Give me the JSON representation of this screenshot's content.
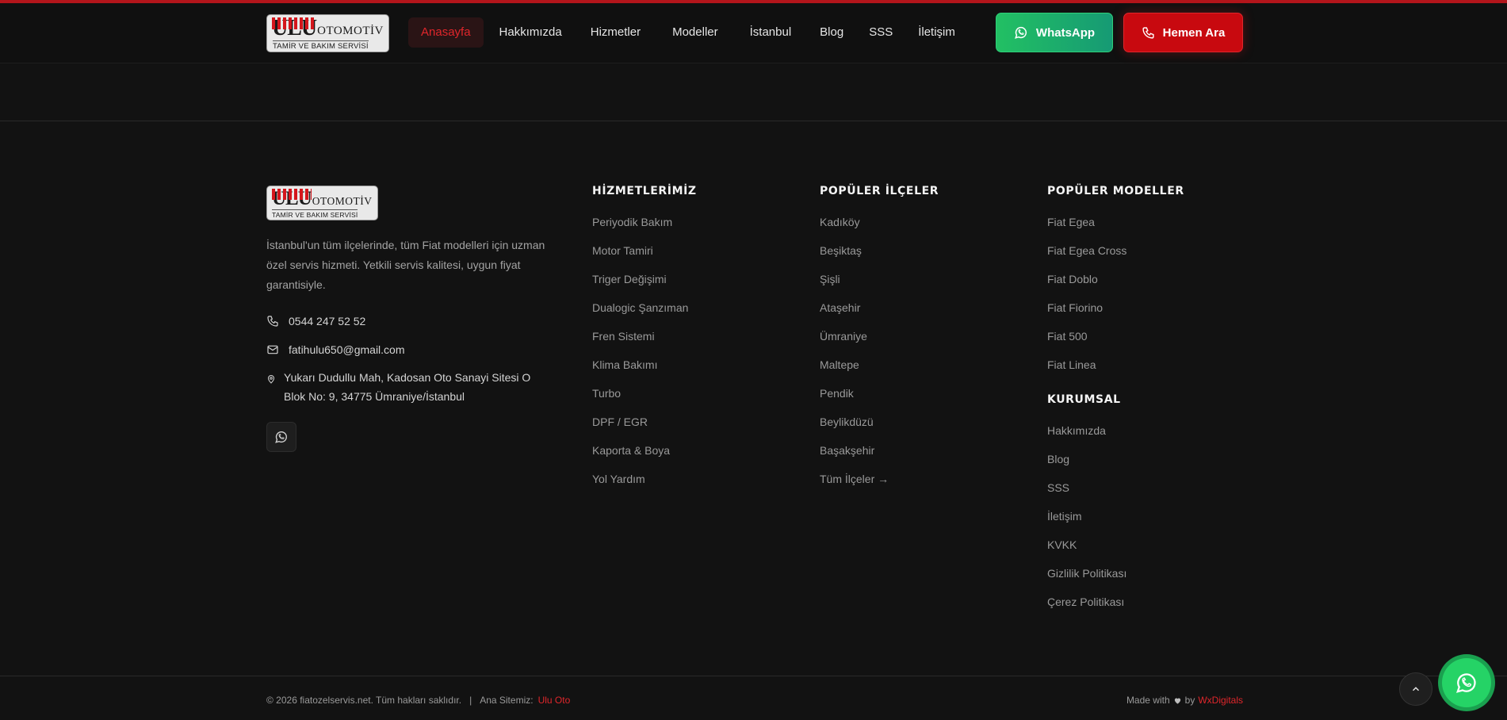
{
  "brand": {
    "logo_main": "ULU",
    "logo_suffix": "OTOMOTİV",
    "logo_tagline": "TAMİR VE BAKIM SERVİSİ"
  },
  "nav": [
    {
      "label": "Anasayfa",
      "active": true
    },
    {
      "label": "Hakkımızda"
    },
    {
      "label": "Hizmetler"
    },
    {
      "label": "Modeller"
    },
    {
      "label": "İstanbul"
    },
    {
      "label": "Blog"
    },
    {
      "label": "SSS"
    },
    {
      "label": "İletişim"
    }
  ],
  "header_buttons": {
    "whatsapp": "WhatsApp",
    "call": "Hemen Ara"
  },
  "footer": {
    "description": "İstanbul'un tüm ilçelerinde, tüm Fiat modelleri için uzman özel servis hizmeti. Yetkili servis kalitesi, uygun fiyat garantisiyle.",
    "phone": "0544 247 52 52",
    "email": "fatihulu650@gmail.com",
    "address": "Yukarı Dudullu Mah, Kadosan Oto Sanayi Sitesi O Blok No: 9, 34775 Ümraniye/İstanbul",
    "services": {
      "title": "HİZMETLERİMİZ",
      "items": [
        "Periyodik Bakım",
        "Motor Tamiri",
        "Triger Değişimi",
        "Dualogic Şanzıman",
        "Fren Sistemi",
        "Klima Bakımı",
        "Turbo",
        "DPF / EGR",
        "Kaporta & Boya",
        "Yol Yardım"
      ]
    },
    "districts": {
      "title": "POPÜLER İLÇELER",
      "items": [
        "Kadıköy",
        "Beşiktaş",
        "Şişli",
        "Ataşehir",
        "Ümraniye",
        "Maltepe",
        "Pendik",
        "Beylikdüzü",
        "Başakşehir",
        "Tüm İlçeler →"
      ]
    },
    "models": {
      "title": "POPÜLER MODELLER",
      "items": [
        "Fiat Egea",
        "Fiat Egea Cross",
        "Fiat Doblo",
        "Fiat Fiorino",
        "Fiat 500",
        "Fiat Linea"
      ]
    },
    "corporate": {
      "title": "KURUMSAL",
      "items": [
        "Hakkımızda",
        "Blog",
        "SSS",
        "İletişim",
        "KVKK",
        "Gizlilik Politikası",
        "Çerez Politikası"
      ]
    },
    "copyright": "© 2026 fiatozelservis.net. Tüm hakları saklıdır.",
    "separator": "|",
    "main_site_label": "Ana Sitemiz:",
    "main_site_link": "Ulu Oto",
    "made_with": "Made with",
    "made_by": "by",
    "made_by_link": "WxDigitals"
  },
  "colors": {
    "accent_red": "#e0262b",
    "whatsapp_green": "#25d366",
    "background": "#121212"
  },
  "icons": [
    "whatsapp-icon",
    "phone-icon",
    "mail-icon",
    "map-pin-icon",
    "heart-icon",
    "chevron-up-icon"
  ]
}
